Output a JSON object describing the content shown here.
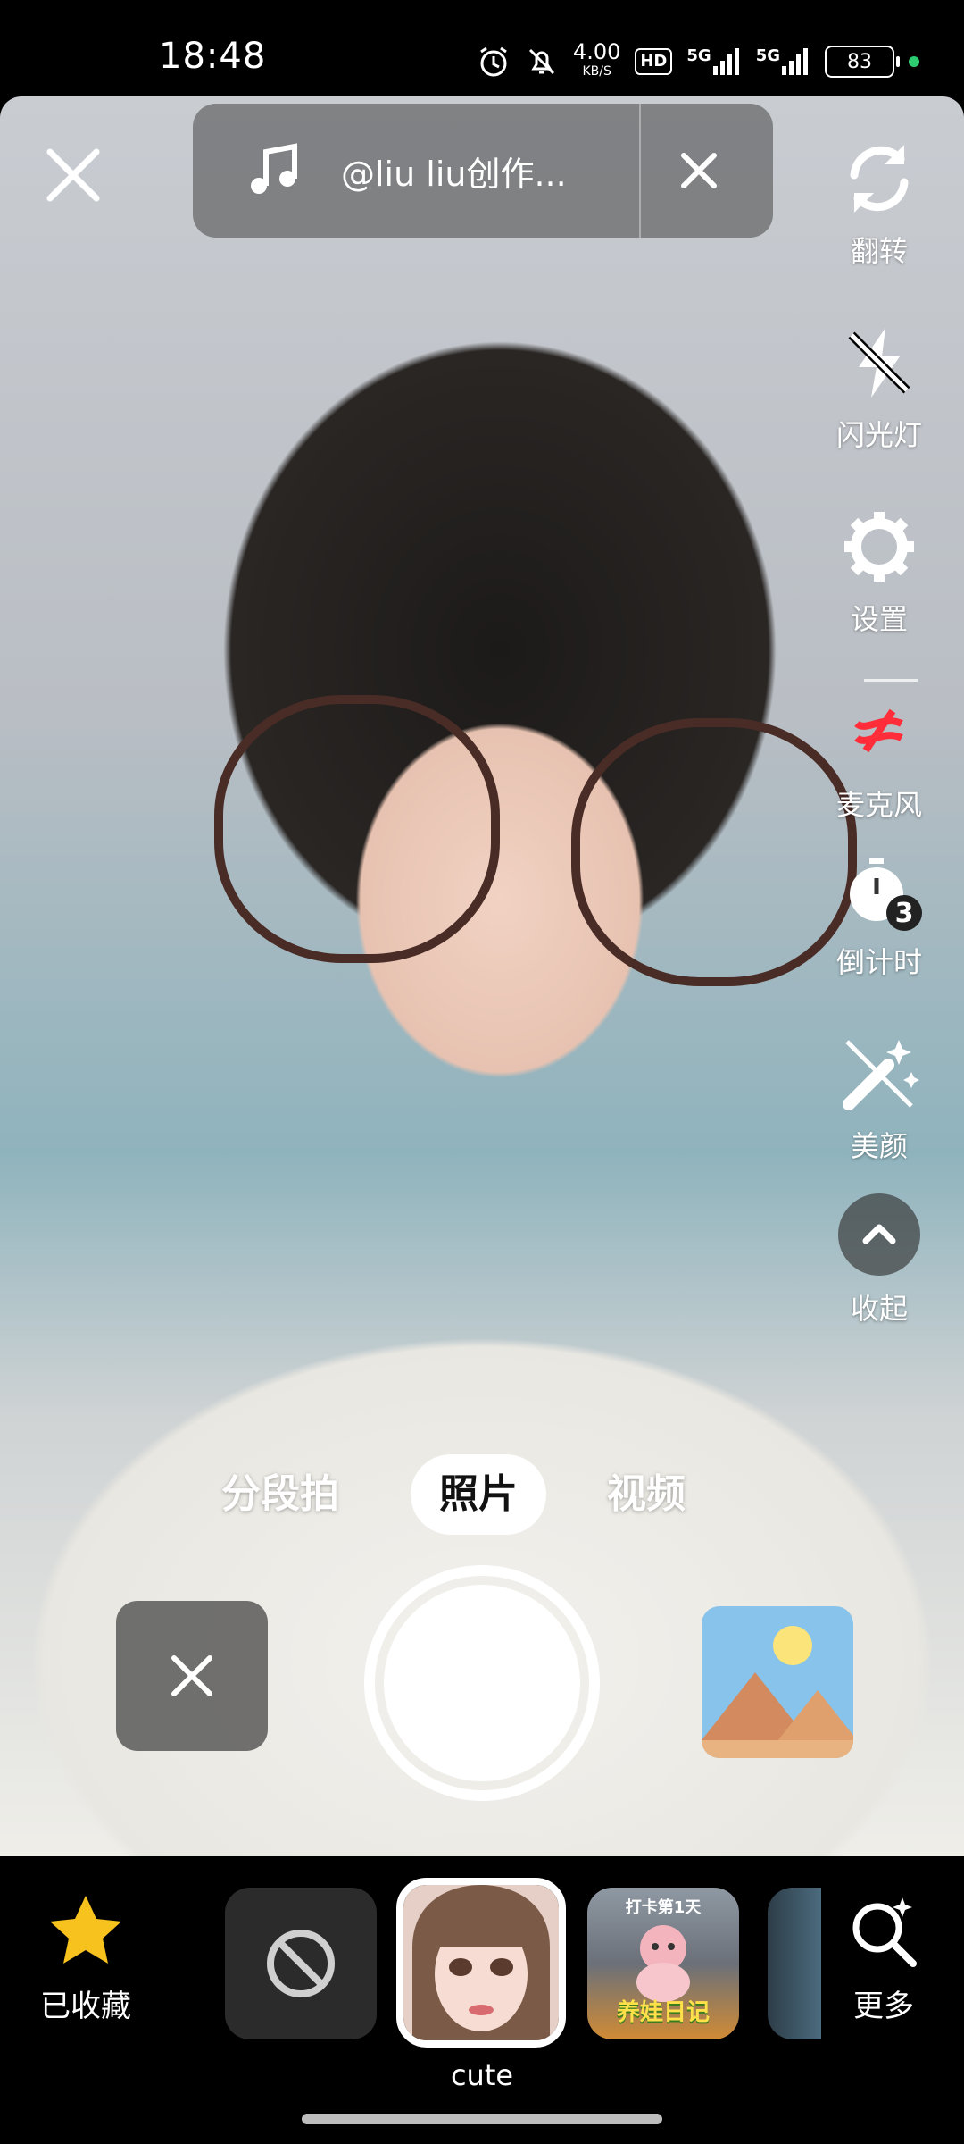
{
  "status_bar": {
    "time": "18:48",
    "net_speed_value": "4.00",
    "net_speed_unit": "KB/S",
    "hd_label": "HD",
    "signal1": "5G",
    "signal2": "5G",
    "battery": "83"
  },
  "top_bar": {
    "music_title": "@liu liu创作..."
  },
  "tools": {
    "flip": "翻转",
    "flash": "闪光灯",
    "settings": "设置",
    "mic": "麦克风",
    "timer": "倒计时",
    "timer_badge": "3",
    "beauty": "美颜",
    "collapse": "收起"
  },
  "modes": [
    "分段拍",
    "照片",
    "视频"
  ],
  "active_mode": "照片",
  "effects_bar": {
    "favorites_label": "已收藏",
    "selected_effect_label": "cute",
    "effect3_caption_top": "打卡第1天",
    "effect3_caption_bottom": "养娃日记",
    "more_label": "更多"
  },
  "colors": {
    "accent_yellow": "#f8c21e",
    "mic_red": "#ff2d3a",
    "status_dot": "#2ecc71"
  }
}
